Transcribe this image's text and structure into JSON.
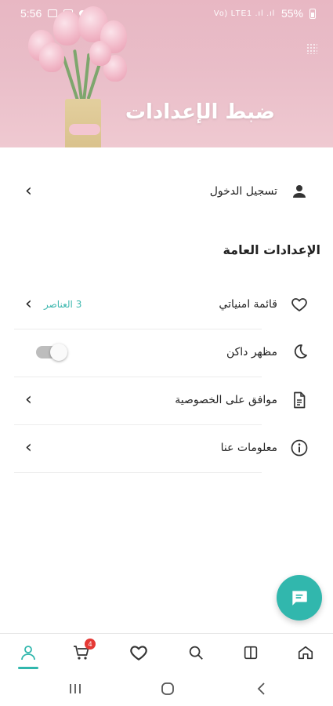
{
  "status_bar": {
    "time": "5:56",
    "battery": "55%",
    "signal_text": "Vo) LTE1 .ıl .ıl"
  },
  "header": {
    "title": "ضبط الإعدادات"
  },
  "login_row": {
    "label": "تسجيل الدخول",
    "icon": "user-icon"
  },
  "general_settings": {
    "title": "الإعدادات العامة",
    "items": [
      {
        "label": "قائمة امنياتي",
        "value": "3 العناصر",
        "icon": "heart-icon",
        "control": "chevron"
      },
      {
        "label": "مظهر داكن",
        "icon": "moon-icon",
        "control": "toggle",
        "toggle_on": false
      },
      {
        "label": "موافق على الخصوصية",
        "icon": "document-icon",
        "control": "chevron"
      },
      {
        "label": "معلومات عنا",
        "icon": "info-icon",
        "control": "chevron"
      }
    ]
  },
  "bottom_nav": {
    "items": [
      "profile",
      "cart",
      "wishlist",
      "search",
      "categories",
      "home"
    ],
    "cart_badge": "4",
    "active": "profile"
  },
  "colors": {
    "accent": "#31b7ad",
    "badge": "#e53935",
    "header_bg": "#e9bdc8"
  }
}
